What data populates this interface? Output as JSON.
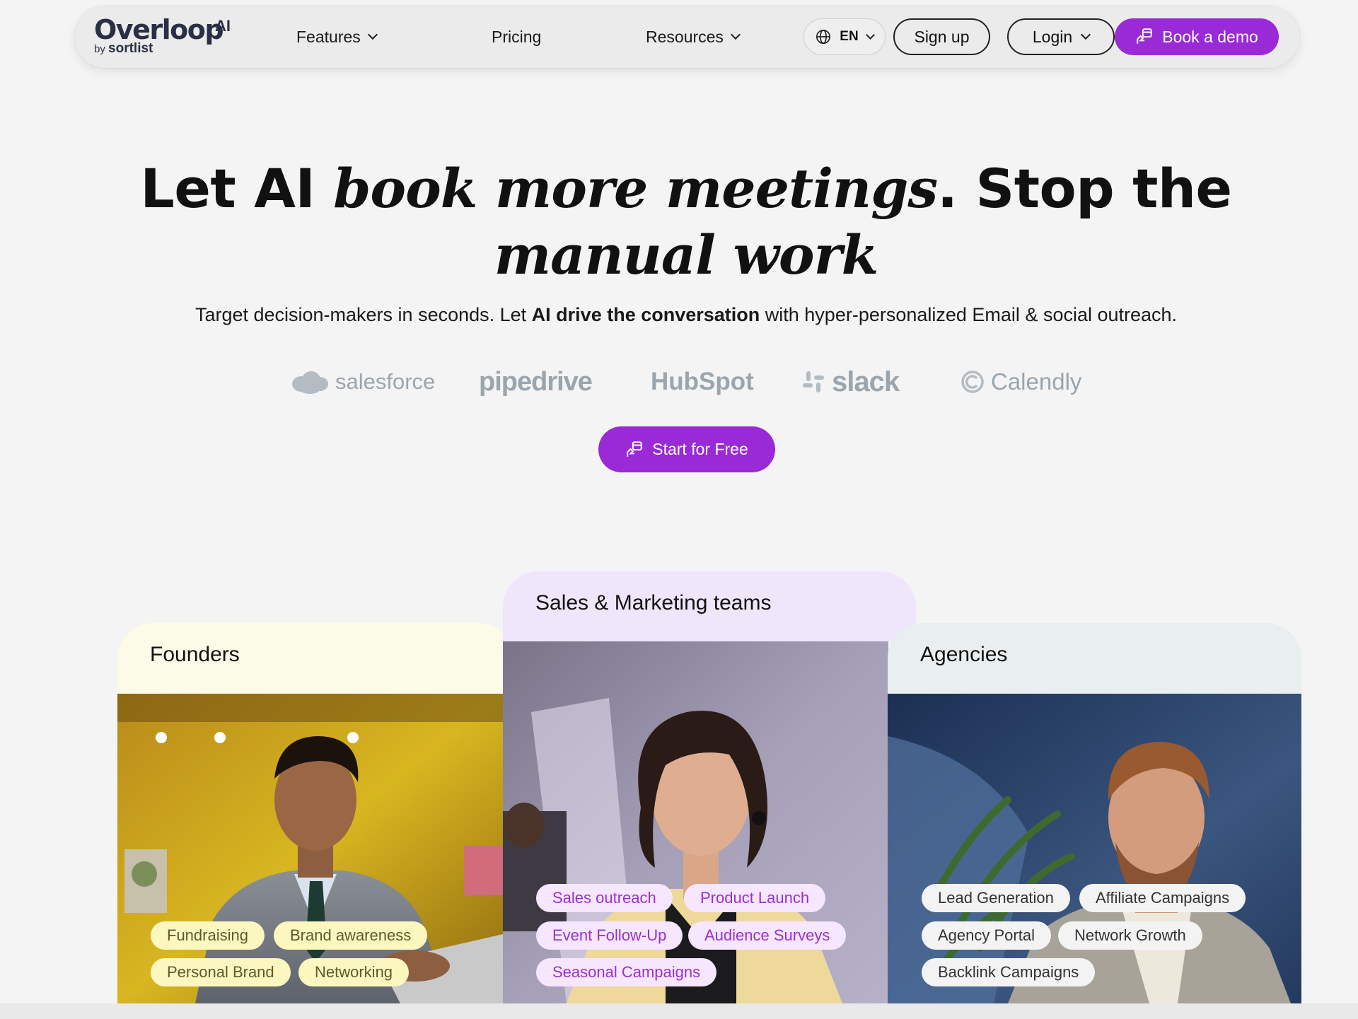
{
  "nav": {
    "logo_main": "Overloop",
    "logo_ai": "AI",
    "logo_by": "by",
    "logo_by_brand": "sortlist",
    "features": "Features",
    "pricing": "Pricing",
    "resources": "Resources",
    "language": "EN",
    "signup": "Sign up",
    "login": "Login",
    "book_demo": "Book a demo"
  },
  "hero": {
    "title_part1": "Let AI ",
    "title_em1": "book more meetings",
    "title_part2": ". Stop the",
    "title_em2": "manual work",
    "subtitle_part1": "Target decision-makers in seconds. Let ",
    "subtitle_bold": "AI drive the conversation",
    "subtitle_part2": " with hyper-personalized Email & social outreach.",
    "cta": "Start for Free"
  },
  "partners": [
    "salesforce",
    "pipedrive",
    "HubSpot",
    "slack",
    "Calendly"
  ],
  "cards": {
    "founders": {
      "title": "Founders",
      "tags": [
        "Fundraising",
        "Brand awareness",
        "Personal Brand",
        "Networking"
      ]
    },
    "sales": {
      "title": "Sales & Marketing teams",
      "tags": [
        "Sales outreach",
        "Product Launch",
        "Event Follow-Up",
        "Audience Surveys",
        "Seasonal Campaigns"
      ]
    },
    "agencies": {
      "title": "Agencies",
      "tags": [
        "Lead Generation",
        "Affiliate Campaigns",
        "Agency Portal",
        "Network Growth",
        "Backlink Campaigns"
      ]
    }
  },
  "colors": {
    "accent": "#9a2ad6",
    "founders_tab": "#fbfbe8",
    "sales_tab": "#efe6fb",
    "agencies_tab": "#e9eeee"
  }
}
